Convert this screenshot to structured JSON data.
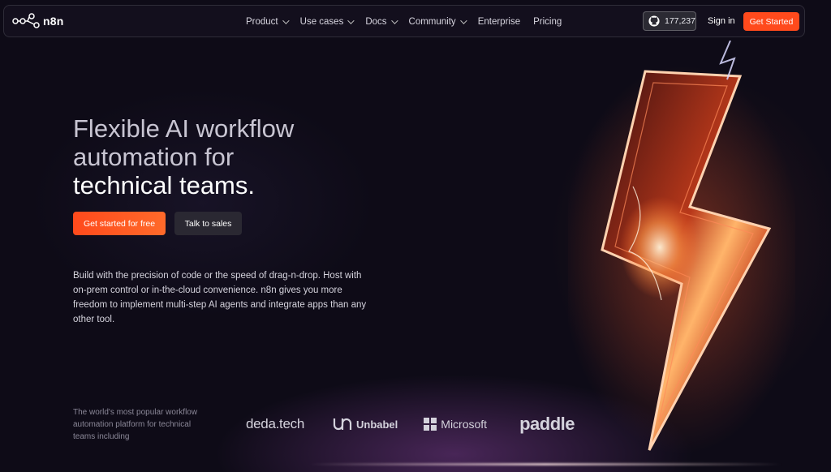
{
  "nav": {
    "logo_text": "n8n",
    "menu": [
      {
        "label": "Product",
        "has_dropdown": true
      },
      {
        "label": "Use cases",
        "has_dropdown": true
      },
      {
        "label": "Docs",
        "has_dropdown": true
      },
      {
        "label": "Community",
        "has_dropdown": true
      },
      {
        "label": "Enterprise",
        "has_dropdown": false
      },
      {
        "label": "Pricing",
        "has_dropdown": false
      }
    ],
    "github_stars": "177,237",
    "github_icon": "github-icon",
    "sign_in": "Sign in",
    "get_started": "Get Started"
  },
  "hero": {
    "title_line1": "Flexible AI workflow",
    "title_line2": "automation for",
    "title_line3": "technical teams.",
    "cta_primary": "Get started for free",
    "cta_secondary": "Talk to sales",
    "description": "Build with the precision of code or the speed of drag-n-drop. Host with on-prem control or in-the-cloud convenience. n8n gives you more freedom to implement multi-step AI agents and integrate apps than any other tool."
  },
  "trust": {
    "tagline": "The world's most popular workflow automation platform for technical teams including",
    "logos": [
      "deda.tech",
      "Unbabel",
      "Microsoft",
      "paddle"
    ]
  },
  "colors": {
    "background": "#0e0b17",
    "accent": "#ff4a1c",
    "secondary_button": "#2a2832"
  }
}
